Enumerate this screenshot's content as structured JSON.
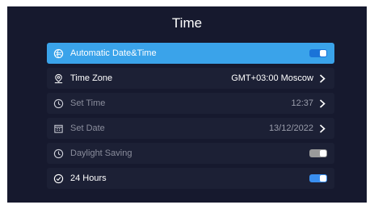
{
  "header": {
    "title": "Time"
  },
  "colors": {
    "background": "#16192e",
    "row": "#1c2035",
    "selected": "#3aa3ea",
    "toggle_on": "#3a8ff0",
    "toggle_off": "#9a9a9a",
    "toggle_on_selected": "#1a73d8"
  },
  "rows": [
    {
      "label": "Automatic Date&Time",
      "icon": "globe-clock-icon",
      "toggle": "on",
      "selected": true
    },
    {
      "label": "Time Zone",
      "icon": "location-pin-icon",
      "value": "GMT+03:00  Moscow"
    },
    {
      "label": "Set Time",
      "icon": "clock-icon",
      "value": "12:37",
      "disabled": true
    },
    {
      "label": "Set Date",
      "icon": "calendar-icon",
      "value": "13/12/2022",
      "disabled": true
    },
    {
      "label": "Daylight Saving",
      "icon": "clock-icon",
      "toggle": "off",
      "disabled": true
    },
    {
      "label": "24 Hours",
      "icon": "clock-icon",
      "toggle": "on"
    }
  ]
}
